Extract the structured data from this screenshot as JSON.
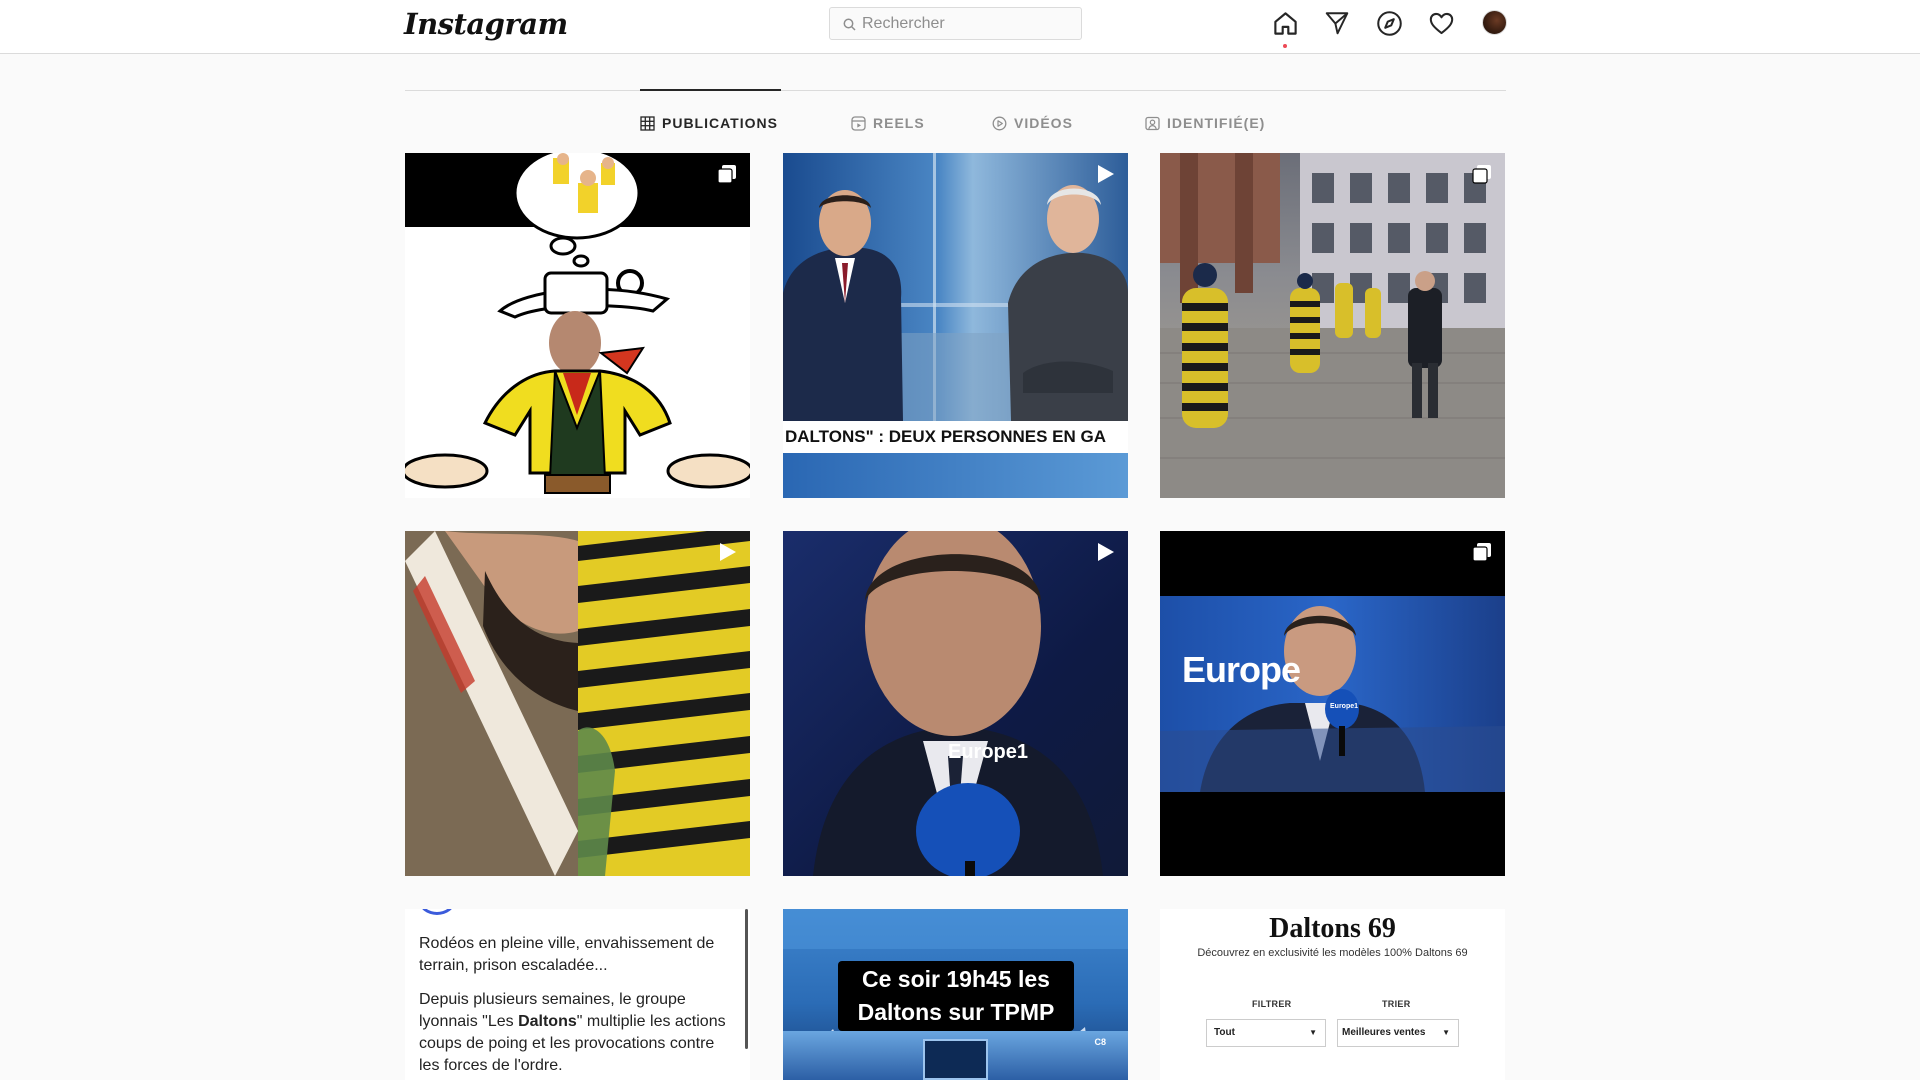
{
  "app": {
    "logo": "Instagram"
  },
  "search": {
    "placeholder": "Rechercher"
  },
  "nav": {
    "icons": [
      "home-icon",
      "direct-icon",
      "explore-icon",
      "activity-heart-icon",
      "profile-avatar"
    ]
  },
  "tabs": [
    {
      "label": "PUBLICATIONS",
      "icon": "grid-icon",
      "active": true
    },
    {
      "label": "REELS",
      "icon": "reels-icon",
      "active": false
    },
    {
      "label": "VIDÉOS",
      "icon": "video-play-icon",
      "active": false
    },
    {
      "label": "IDENTIFIÉ(E)",
      "icon": "tagged-icon",
      "active": false
    }
  ],
  "posts": [
    {
      "type": "carousel",
      "badge": "carousel-icon"
    },
    {
      "type": "video",
      "badge": "play-icon",
      "ticker": "DALTONS\" : DEUX PERSONNES EN GA"
    },
    {
      "type": "carousel",
      "badge": "carousel-icon"
    },
    {
      "type": "video",
      "badge": "play-icon"
    },
    {
      "type": "video",
      "badge": "play-icon",
      "mic_label": "Europe1"
    },
    {
      "type": "carousel",
      "badge": "carousel-icon",
      "backdrop_label": "Europe",
      "mic_label": "Europe1"
    },
    {
      "type": "text",
      "lead": "Rodéos en pleine ville, envahissement de terrain, prison escaladée...",
      "body_before": "Depuis plusieurs semaines, le groupe lyonnais \"Les ",
      "body_bold": "Daltons",
      "body_after": "\" multiplie les actions coups de poing et les provocations contre les forces de l'ordre."
    },
    {
      "type": "promo",
      "caption_line1": "Ce soir 19h45 les",
      "caption_line2": "Daltons sur TPMP",
      "corner_mark": "C8"
    },
    {
      "type": "shop",
      "title": "Daltons 69",
      "subtitle": "Découvrez en exclusivité les modèles 100% Daltons 69",
      "filter_label": "FILTRER",
      "sort_label": "TRIER",
      "filter_value": "Tout",
      "sort_value": "Meilleures ventes"
    }
  ]
}
